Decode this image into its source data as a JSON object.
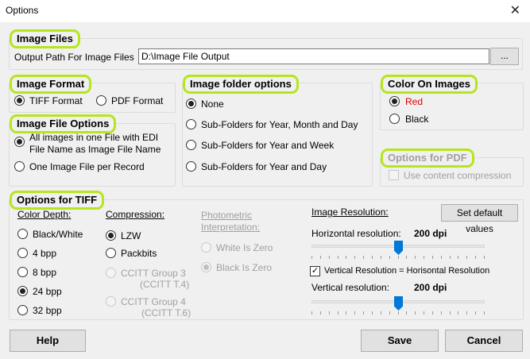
{
  "window": {
    "title": "Options",
    "close_glyph": "✕"
  },
  "image_files": {
    "legend": "Image Files",
    "output_path_label": "Output Path For Image Files",
    "output_path_value": "D:\\Image File Output",
    "browse_label": "..."
  },
  "image_format": {
    "legend": "Image Format",
    "options": [
      "TIFF Format",
      "PDF Format"
    ],
    "selected": "TIFF Format"
  },
  "image_file_options": {
    "legend": "Image File Options",
    "option_all_line1": "All images in one File with EDI",
    "option_all_line2": "File Name as Image File Name",
    "option_one": "One Image File per Record",
    "selected": "all"
  },
  "folder_options": {
    "legend": "Image folder options",
    "options": [
      "None",
      "Sub-Folders for Year, Month and Day",
      "Sub-Folders for Year and Week",
      "Sub-Folders for Year and Day"
    ],
    "selected": "None"
  },
  "color_on_images": {
    "legend": "Color On Images",
    "options": [
      "Red",
      "Black"
    ],
    "selected": "Red",
    "red_color": "#e00000"
  },
  "pdf_options": {
    "legend": "Options for PDF",
    "use_compression": "Use content compression",
    "use_compression_checked": false
  },
  "tiff": {
    "legend": "Options for TIFF",
    "color_depth_label": "Color Depth:",
    "color_depths": [
      "Black/White",
      "4 bpp",
      "8 bpp",
      "24 bpp",
      "32 bpp"
    ],
    "color_depth_selected": "24 bpp",
    "compression_label": "Compression:",
    "compression_lzw": "LZW",
    "compression_packbits": "Packbits",
    "compression_g3_line1": "CCITT Group 3",
    "compression_g3_line2": "(CCITT T.4)",
    "compression_g4_line1": "CCITT Group 4",
    "compression_g4_line2": "(CCITT T.6)",
    "compression_selected": "LZW",
    "photometric_line1": "Photometric",
    "photometric_line2": "Interpretation:",
    "photometric_options": [
      "White Is Zero",
      "Black Is Zero"
    ],
    "photometric_selected": "Black Is Zero",
    "resolution_label": "Image Resolution:",
    "set_default_label": "Set default values",
    "horizontal_label": "Horizontal resolution:",
    "horizontal_value": "200 dpi",
    "horizontal_slider_fraction": 0.5,
    "vertical_equals_label": "Vertical Resolution = Horisontal Resolution",
    "vertical_equals_checked": true,
    "vertical_label": "Vertical resolution:",
    "vertical_value": "200 dpi",
    "vertical_slider_fraction": 0.5
  },
  "buttons": {
    "help": "Help",
    "save": "Save",
    "cancel": "Cancel"
  },
  "accent_highlight": "#b5e61d",
  "slider_color": "#0078d7"
}
